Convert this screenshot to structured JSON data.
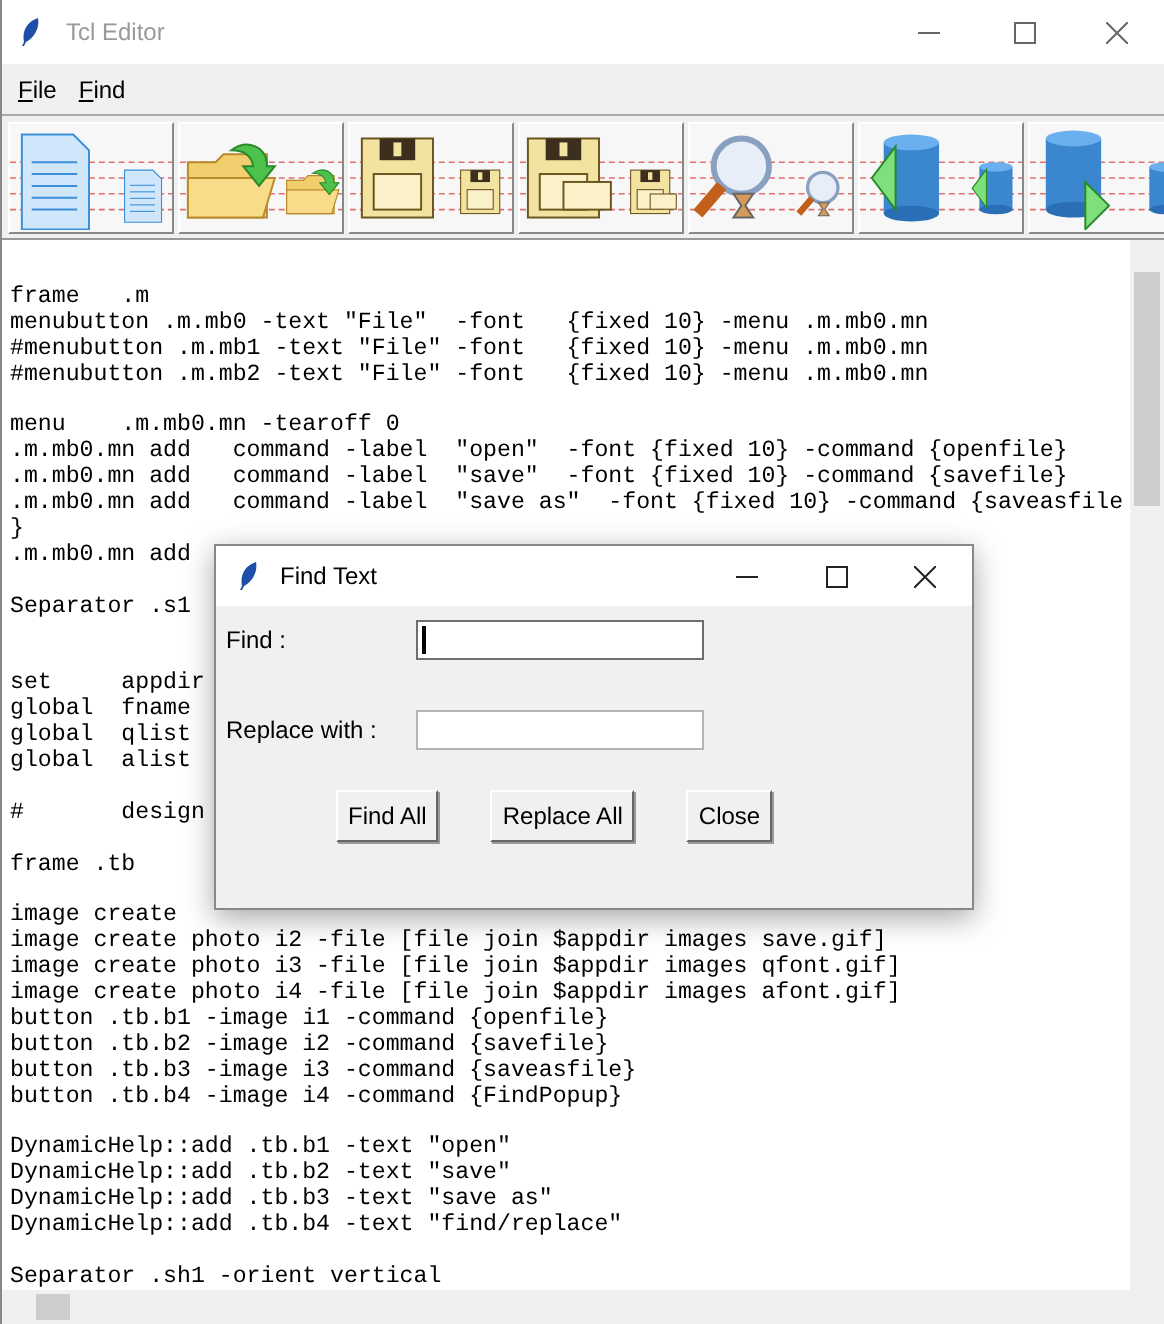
{
  "window": {
    "title": "Tcl Editor",
    "active": false
  },
  "menu": [
    {
      "label": "File"
    },
    {
      "label": "Find"
    }
  ],
  "toolbar": [
    {
      "kind": "new"
    },
    {
      "kind": "open"
    },
    {
      "kind": "save"
    },
    {
      "kind": "saveas"
    },
    {
      "kind": "find"
    },
    {
      "kind": "back"
    },
    {
      "kind": "forward"
    }
  ],
  "editor_blocks": [
    {
      "kind": "code",
      "lines": [
        "frame   .m",
        "menubutton .m.mb0 -text \"File\"  -font   {fixed 10} -menu .m.mb0.mn",
        "#menubutton .m.mb1 -text \"File\" -font   {fixed 10} -menu .m.mb0.mn",
        "#menubutton .m.mb2 -text \"File\" -font   {fixed 10} -menu .m.mb0.mn"
      ]
    },
    {
      "kind": "code",
      "lines": [
        "menu    .m.mb0.mn -tearoff 0",
        ".m.mb0.mn add   command -label  \"open\"  -font {fixed 10} -command {openfile}",
        ".m.mb0.mn add   command -label  \"save\"  -font {fixed 10} -command {savefile}",
        ".m.mb0.mn add   command -label  \"save as\"  -font {fixed 10} -command {saveasfile",
        "}",
        ".m.mb0.mn add"
      ]
    },
    {
      "kind": "separator",
      "lines": [
        "Separator .s1"
      ]
    },
    {
      "kind": "code",
      "lines": [
        "set     appdir",
        "global  fname",
        "global  qlist",
        "global  alist"
      ]
    },
    {
      "kind": "code",
      "lines": [
        "#       design"
      ]
    },
    {
      "kind": "code",
      "lines": [
        "frame .tb"
      ]
    },
    {
      "kind": "code",
      "lines": [
        "image create",
        "image create photo i2 -file [file join $appdir images save.gif]",
        "image create photo i3 -file [file join $appdir images qfont.gif]",
        "image create photo i4 -file [file join $appdir images afont.gif]",
        "button .tb.b1 -image i1 -command {openfile}",
        "button .tb.b2 -image i2 -command {savefile}",
        "button .tb.b3 -image i3 -command {saveasfile}",
        "button .tb.b4 -image i4 -command {FindPopup}"
      ]
    },
    {
      "kind": "code",
      "lines": [
        "DynamicHelp::add .tb.b1 -text \"open\"",
        "DynamicHelp::add .tb.b2 -text \"save\"",
        "DynamicHelp::add .tb.b3 -text \"save as\"",
        "DynamicHelp::add .tb.b4 -text \"find/replace\""
      ]
    },
    {
      "kind": "code",
      "lines": [
        "Separator .sh1 -orient vertical"
      ]
    }
  ],
  "find_dialog": {
    "title": "Find Text",
    "active": true,
    "fields": [
      {
        "label": "Find :",
        "focused": true
      },
      {
        "label": "Replace with :",
        "focused": false
      }
    ],
    "buttons": [
      "Find All",
      "Replace All",
      "Close"
    ]
  }
}
